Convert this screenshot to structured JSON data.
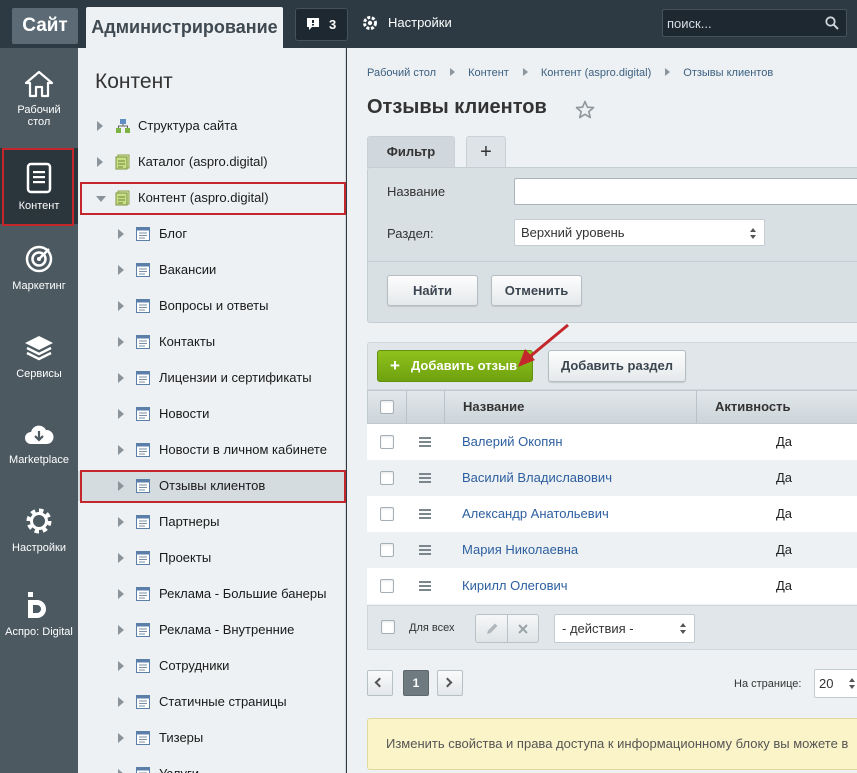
{
  "topbar": {
    "site_tab": "Сайт",
    "admin_tab": "Администрирование",
    "notifications_count": "3",
    "settings_label": "Настройки",
    "search_placeholder": "поиск..."
  },
  "sidebar": {
    "items": [
      {
        "label_line1": "Рабочий",
        "label_line2": "стол",
        "icon": "home-icon"
      },
      {
        "label_line1": "Контент",
        "label_line2": "",
        "icon": "document-icon"
      },
      {
        "label_line1": "Маркетинг",
        "label_line2": "",
        "icon": "target-icon"
      },
      {
        "label_line1": "Сервисы",
        "label_line2": "",
        "icon": "layers-icon"
      },
      {
        "label_line1": "Marketplace",
        "label_line2": "",
        "icon": "cloud-download-icon"
      },
      {
        "label_line1": "Настройки",
        "label_line2": "",
        "icon": "gear-icon"
      },
      {
        "label_line1": "Аспро: Digital",
        "label_line2": "",
        "icon": "aspro-logo-icon"
      }
    ]
  },
  "tree": {
    "title": "Контент",
    "items": [
      {
        "label": "Структура сайта"
      },
      {
        "label": "Каталог (aspro.digital)"
      },
      {
        "label": "Контент (aspro.digital)"
      },
      {
        "label": "Блог"
      },
      {
        "label": "Вакансии"
      },
      {
        "label": "Вопросы и ответы"
      },
      {
        "label": "Контакты"
      },
      {
        "label": "Лицензии и сертификаты"
      },
      {
        "label": "Новости"
      },
      {
        "label": "Новости в личном кабинете"
      },
      {
        "label": "Отзывы клиентов"
      },
      {
        "label": "Партнеры"
      },
      {
        "label": "Проекты"
      },
      {
        "label": "Реклама - Большие банеры"
      },
      {
        "label": "Реклама - Внутренние"
      },
      {
        "label": "Сотрудники"
      },
      {
        "label": "Статичные страницы"
      },
      {
        "label": "Тизеры"
      },
      {
        "label": "Услуги"
      }
    ]
  },
  "breadcrumb": [
    "Рабочий стол",
    "Контент",
    "Контент (aspro.digital)",
    "Отзывы клиентов"
  ],
  "page": {
    "title": "Отзывы клиентов"
  },
  "filter": {
    "tab_label": "Фильтр",
    "add_tab": "+",
    "name_label": "Название",
    "name_value": "",
    "section_label": "Раздел:",
    "section_value": "Верхний уровень",
    "find_button": "Найти",
    "cancel_button": "Отменить"
  },
  "toolbar": {
    "add_review": "Добавить отзыв",
    "add_section": "Добавить раздел"
  },
  "grid": {
    "columns": [
      "Название",
      "Активность"
    ],
    "rows": [
      {
        "name": "Валерий Окопян",
        "active": "Да"
      },
      {
        "name": "Василий Владиславович",
        "active": "Да"
      },
      {
        "name": "Александр Анатольевич",
        "active": "Да"
      },
      {
        "name": "Мария Николаевна",
        "active": "Да"
      },
      {
        "name": "Кирилл Олегович",
        "active": "Да"
      }
    ],
    "for_all": "Для всех",
    "actions_placeholder": "- действия -"
  },
  "pagination": {
    "current_page": "1",
    "per_page_label": "На странице:",
    "per_page_value": "20"
  },
  "notice": {
    "text": "Изменить свойства и права доступа к информационному блоку вы можете в"
  },
  "colors": {
    "accent_green": "#7ab317",
    "highlight_red": "#c3262b",
    "link_blue": "#2d5fa0"
  }
}
